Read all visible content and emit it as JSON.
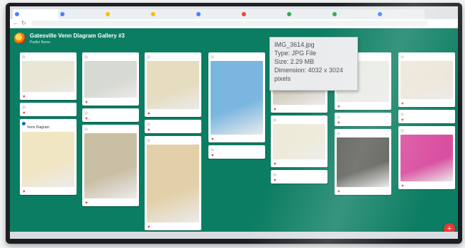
{
  "browser": {
    "tabs": [
      {
        "label": "",
        "fav": "#4285f4"
      },
      {
        "label": "",
        "fav": "#4285f4"
      },
      {
        "label": "",
        "fav": "#fbbc04"
      },
      {
        "label": "",
        "fav": "#fbbc04"
      },
      {
        "label": "",
        "fav": "#4285f4"
      },
      {
        "label": "",
        "fav": "#ea4335"
      },
      {
        "label": "",
        "fav": "#34a853"
      },
      {
        "label": "",
        "fav": "#34a853"
      },
      {
        "label": "",
        "fav": "#4285f4"
      }
    ]
  },
  "app": {
    "title": "Gatesville Venn Diagram Gallery #3",
    "subtitle": "Padlet Name",
    "accent": "#0b7d62"
  },
  "tooltip": {
    "name": "IMG_3614.jpg",
    "type": "Type: JPG File",
    "size": "Size: 2.29 MB",
    "dimension": "Dimension: 4032 x 3024",
    "dimension_unit": "pixels"
  },
  "columns": [
    {
      "cards": [
        {
          "author": "",
          "title": "",
          "text": "",
          "image": "#eae6d5",
          "img_h": 44,
          "avatar": "#e0e0e0"
        },
        {
          "author": "",
          "title": "",
          "text": "",
          "image": null,
          "avatar": "#e0e0e0"
        },
        {
          "author": "",
          "title": "Venn Diagram",
          "text": "",
          "image": "#f1e6c4",
          "img_h": 78,
          "avatar": "#1565c0"
        }
      ]
    },
    {
      "cards": [
        {
          "author": "",
          "title": "",
          "text": "",
          "image": "#d7d9d3",
          "img_h": 52,
          "avatar": "#e0e0e0"
        },
        {
          "author": "",
          "title": "",
          "text": "",
          "image": null,
          "avatar": "#e0e0e0"
        },
        {
          "author": "",
          "title": "",
          "text": "",
          "image": "#c9bfa5",
          "img_h": 92,
          "avatar": "#e0e0e0"
        }
      ]
    },
    {
      "cards": [
        {
          "author": "",
          "title": "",
          "text": "",
          "image": "#e6dcc0",
          "img_h": 68,
          "avatar": "#e0e0e0"
        },
        {
          "author": "",
          "title": "",
          "text": "",
          "image": null,
          "avatar": "#e0e0e0"
        },
        {
          "author": "",
          "title": "",
          "text": "",
          "image": "#e3d0a8",
          "img_h": 110,
          "avatar": "#e0e0e0"
        }
      ]
    },
    {
      "cards": [
        {
          "author": "",
          "title": "",
          "text": "",
          "image": "#7ab6e0",
          "img_h": 104,
          "avatar": "#e0e0e0"
        },
        {
          "author": "",
          "title": "",
          "text": "",
          "image": null,
          "avatar": "#e0e0e0"
        }
      ]
    },
    {
      "cards": [
        {
          "author": "",
          "title": "",
          "text": "",
          "image": "#d5d0c2",
          "img_h": 62,
          "avatar": "#e0e0e0"
        },
        {
          "author": "",
          "title": "",
          "text": "",
          "image": "#eeead9",
          "img_h": 50,
          "avatar": "#e0e0e0"
        },
        {
          "author": "",
          "title": "",
          "text": "",
          "image": null,
          "avatar": "#e0e0e0"
        }
      ]
    },
    {
      "cards": [
        {
          "author": "",
          "title": "",
          "text": "",
          "image": "#e9ebe6",
          "img_h": 58,
          "avatar": "#e0e0e0"
        },
        {
          "author": "",
          "title": "",
          "text": "",
          "image": null,
          "avatar": "#e0e0e0"
        },
        {
          "author": "",
          "title": "",
          "text": "",
          "image": "#5a5a55",
          "img_h": 70,
          "avatar": "#e0e0e0"
        }
      ]
    },
    {
      "cards": [
        {
          "author": "",
          "title": "",
          "text": "",
          "image": "#ece6d8",
          "img_h": 54,
          "avatar": "#e0e0e0"
        },
        {
          "author": "",
          "title": "",
          "text": "",
          "image": null,
          "avatar": "#e0e0e0"
        },
        {
          "author": "",
          "title": "",
          "text": "",
          "image": "#d94fa0",
          "img_h": 66,
          "avatar": "#e0e0e0"
        }
      ]
    }
  ],
  "fab": {
    "icon": "+",
    "color": "#e53935"
  }
}
